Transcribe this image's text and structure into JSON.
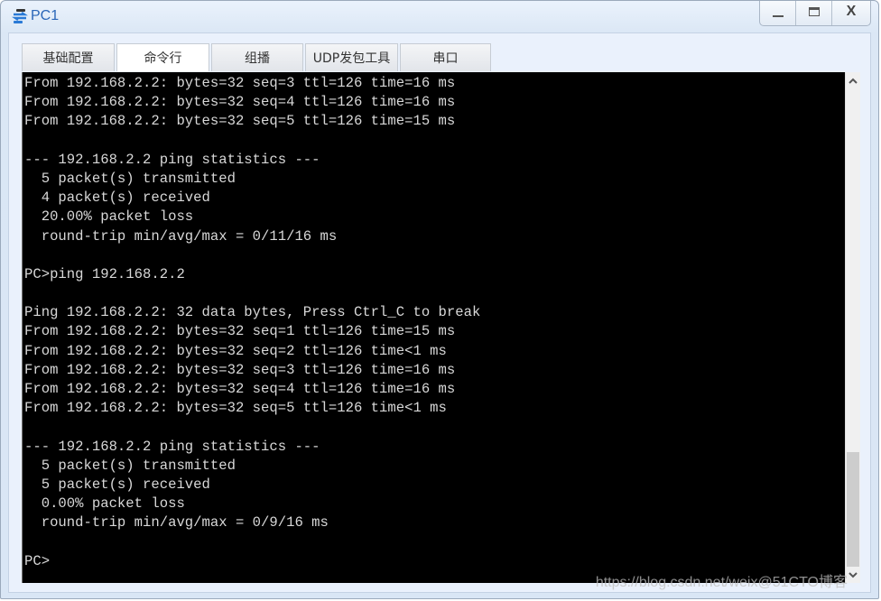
{
  "window": {
    "title": "PC1",
    "icon": "network-device-icon",
    "controls": {
      "minimize": "minimize-icon",
      "maximize": "maximize-icon",
      "close_label": "X"
    }
  },
  "tabs": [
    {
      "label": "基础配置",
      "active": false
    },
    {
      "label": "命令行",
      "active": true
    },
    {
      "label": "组播",
      "active": false
    },
    {
      "label": "UDP发包工具",
      "active": false
    },
    {
      "label": "串口",
      "active": false
    }
  ],
  "terminal": {
    "lines": [
      "From 192.168.2.2: bytes=32 seq=3 ttl=126 time=16 ms",
      "From 192.168.2.2: bytes=32 seq=4 ttl=126 time=16 ms",
      "From 192.168.2.2: bytes=32 seq=5 ttl=126 time=15 ms",
      "",
      "--- 192.168.2.2 ping statistics ---",
      "  5 packet(s) transmitted",
      "  4 packet(s) received",
      "  20.00% packet loss",
      "  round-trip min/avg/max = 0/11/16 ms",
      "",
      "PC>ping 192.168.2.2",
      "",
      "Ping 192.168.2.2: 32 data bytes, Press Ctrl_C to break",
      "From 192.168.2.2: bytes=32 seq=1 ttl=126 time=15 ms",
      "From 192.168.2.2: bytes=32 seq=2 ttl=126 time<1 ms",
      "From 192.168.2.2: bytes=32 seq=3 ttl=126 time=16 ms",
      "From 192.168.2.2: bytes=32 seq=4 ttl=126 time=16 ms",
      "From 192.168.2.2: bytes=32 seq=5 ttl=126 time<1 ms",
      "",
      "--- 192.168.2.2 ping statistics ---",
      "  5 packet(s) transmitted",
      "  5 packet(s) received",
      "  0.00% packet loss",
      "  round-trip min/avg/max = 0/9/16 ms",
      "",
      "PC>"
    ]
  },
  "scrollbar": {
    "position_fraction": 1.0,
    "visible_fraction": 0.24,
    "up_arrow": "▲",
    "down_arrow": "▼"
  },
  "watermark": "https://blog.csdn.net/weix@51CTO博客"
}
